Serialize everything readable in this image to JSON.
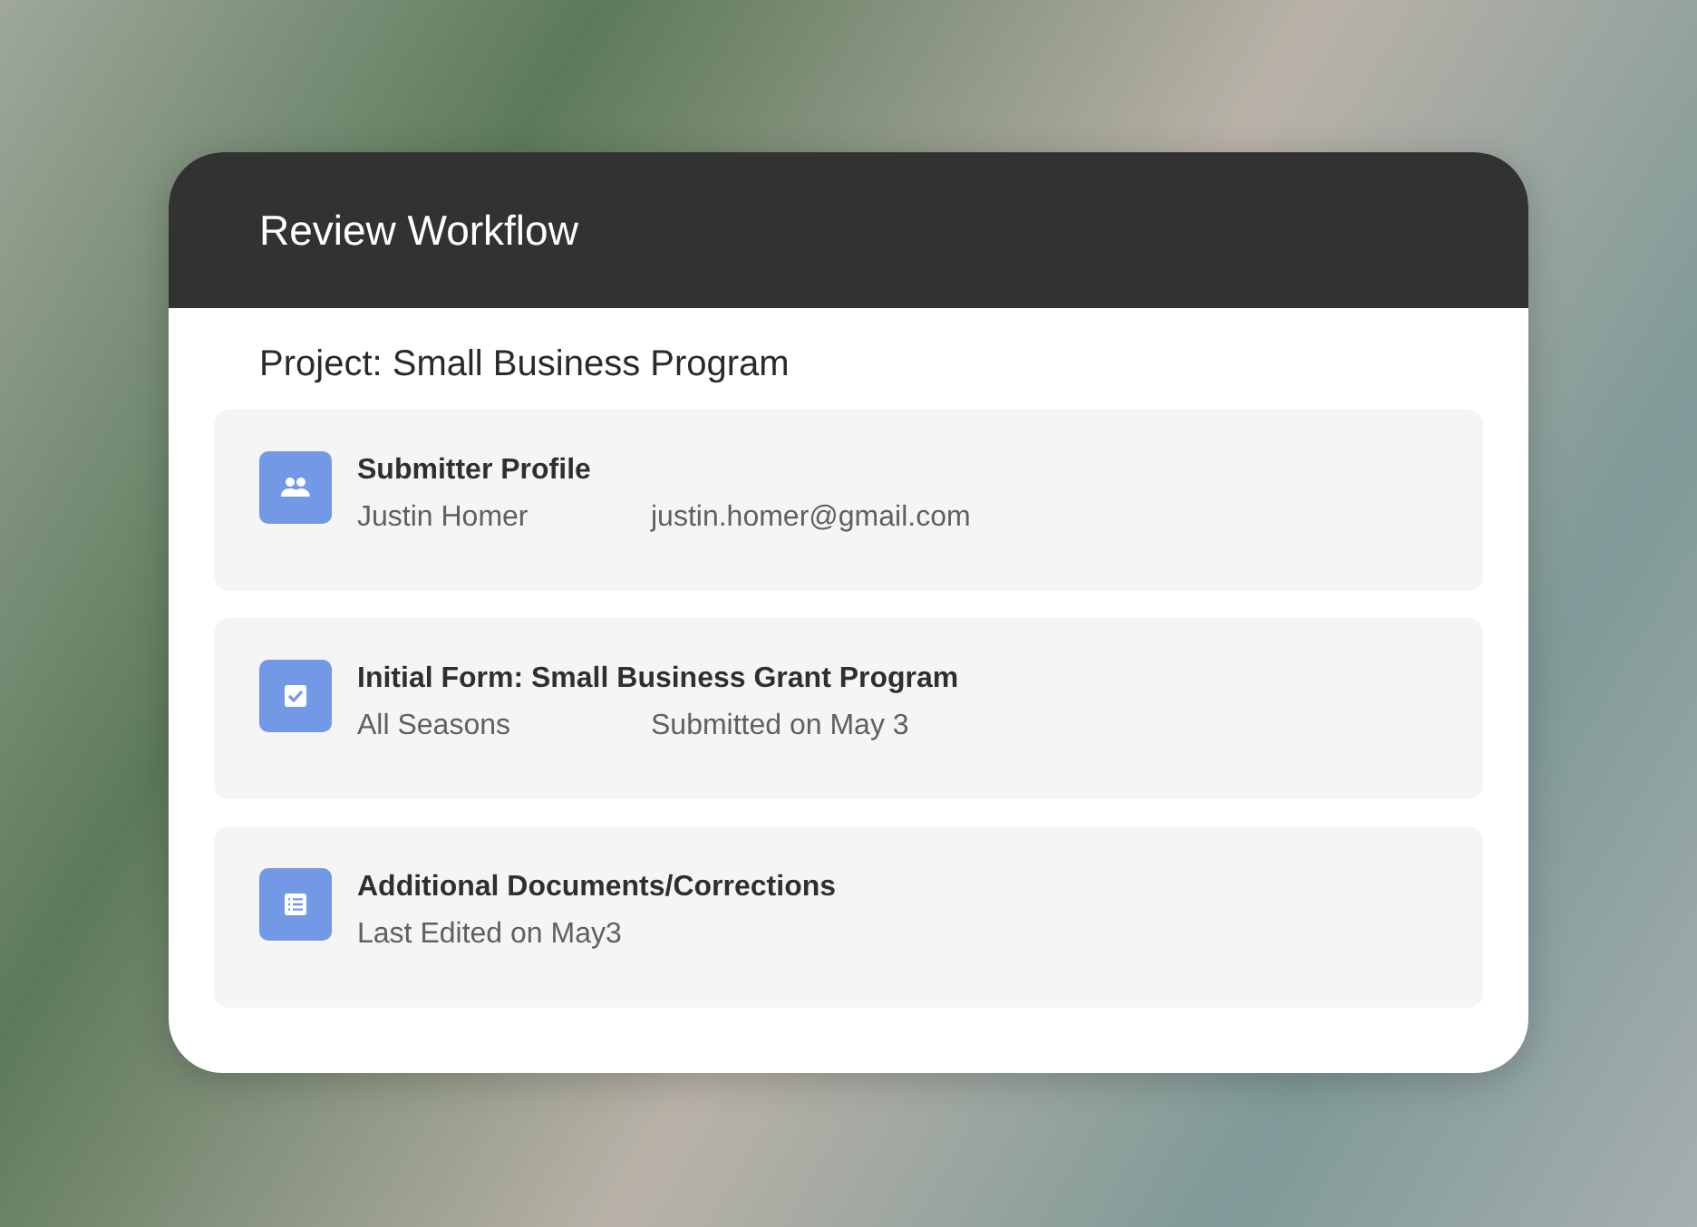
{
  "window": {
    "title": "Review Workflow"
  },
  "project": {
    "label": "Project: Small Business Program"
  },
  "items": [
    {
      "kind": "people",
      "title": "Submitter Profile",
      "details": [
        "Justin Homer",
        "justin.homer@gmail.com"
      ]
    },
    {
      "kind": "check",
      "title": "Initial Form: Small Business Grant Program",
      "details": [
        "All Seasons",
        "Submitted on May 3"
      ]
    },
    {
      "kind": "list",
      "title": "Additional Documents/Corrections",
      "details": [
        "Last Edited on May3"
      ]
    }
  ]
}
